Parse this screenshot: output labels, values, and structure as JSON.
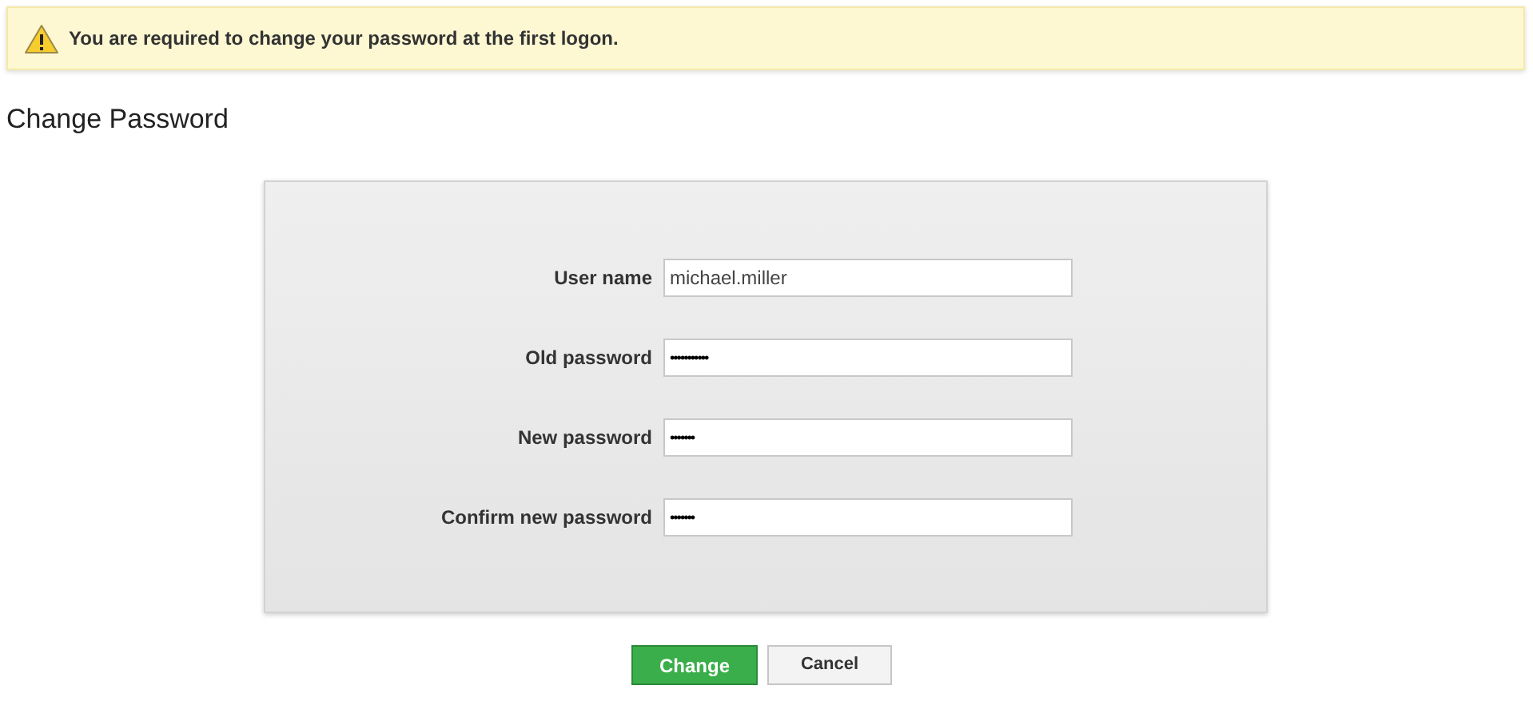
{
  "banner": {
    "message": "You are required to change your password at the first logon."
  },
  "heading": "Change Password",
  "fields": [
    {
      "label": "User name",
      "value": "michael.miller",
      "kind": "text"
    },
    {
      "label": "Old password",
      "value": "•••••••••••",
      "kind": "password"
    },
    {
      "label": "New password",
      "value": "•••••••",
      "kind": "password"
    },
    {
      "label": "Confirm new password",
      "value": "•••••••",
      "kind": "password"
    }
  ],
  "buttons": [
    {
      "label": "Change",
      "kind": "primary"
    },
    {
      "label": "Cancel",
      "kind": "secondary"
    }
  ]
}
